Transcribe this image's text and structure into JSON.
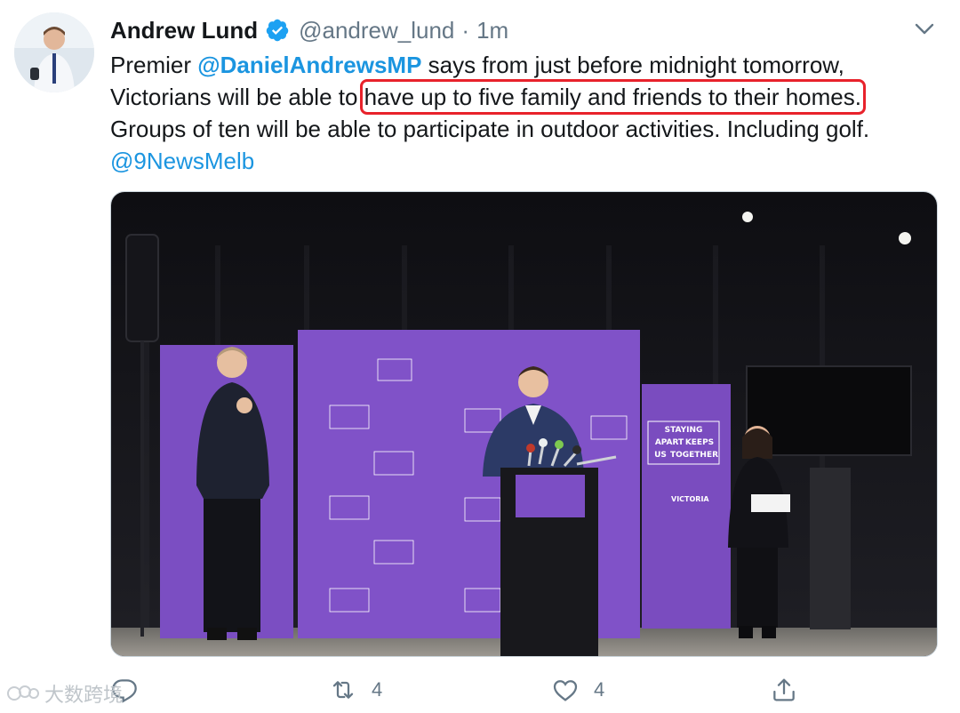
{
  "tweet": {
    "display_name": "Andrew Lund",
    "handle": "@andrew_lund",
    "separator": "·",
    "time": "1m",
    "text": {
      "line1_before": "Premier ",
      "mention1": "@DanielAndrewsMP",
      "line1_after": " says from just before midnight tomorrow,",
      "line2_before": "Victorians will be able to ",
      "highlight": "have up to five family and friends to their homes.",
      "line3": "Groups of ten will be able to participate in outdoor activities. Including golf.",
      "mention2": "@9NewsMelb"
    }
  },
  "media": {
    "backdrop_text": [
      "STAYING",
      "APART",
      "KEEPS",
      "US",
      "TOGETHER"
    ],
    "brand_text": "VICTORIA",
    "colors": {
      "backdrop": "#7d4fc4",
      "stage": "#1b1b1f"
    }
  },
  "actions": {
    "retweets": "4",
    "likes": "4"
  },
  "watermark": "大数跨境",
  "colors": {
    "link": "#1b95e0",
    "highlight_box": "#e8222b",
    "muted": "#657786"
  }
}
